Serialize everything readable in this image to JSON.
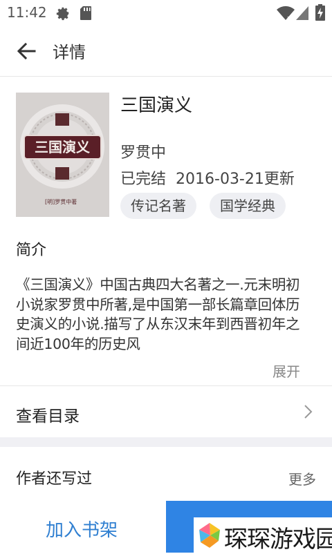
{
  "status_bar": {
    "time": "11:42",
    "icons": [
      "gear-icon",
      "sd-card-icon",
      "wifi-icon",
      "signal-icon",
      "battery-icon"
    ]
  },
  "app_bar": {
    "title": "详情",
    "back_icon": "arrow-left-icon"
  },
  "book": {
    "title": "三国演义",
    "cover_title": "三国演义",
    "cover_author_mark": "[明]罗贯中著",
    "author": "罗贯中",
    "status": "已完结",
    "updated": "2016-03-21更新",
    "tags": [
      "传记名著",
      "国学经典"
    ]
  },
  "intro": {
    "heading": "简介",
    "text": "《三国演义》中国古典四大名著之一.元末明初小说家罗贯中所著,是中国第一部长篇章回体历史演义的小说.描写了从东汉末年到西晋初年之间近100年的历史风",
    "expand": "展开"
  },
  "toc": {
    "label": "查看目录"
  },
  "author_works": {
    "label": "作者还写过",
    "more": "更多"
  },
  "bottom": {
    "add_shelf": "加入书架"
  },
  "watermark": {
    "text": "琛琛游戏园"
  },
  "colors": {
    "accent": "#2f84e4",
    "link": "#2f7fd1",
    "tag_bg": "#eeeff3"
  }
}
